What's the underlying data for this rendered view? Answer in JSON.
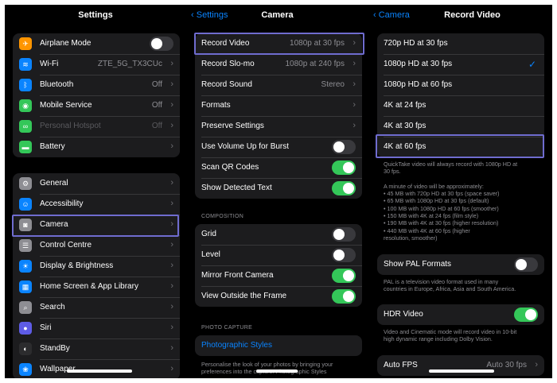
{
  "panel1": {
    "title": "Settings",
    "group1": [
      {
        "label": "Airplane Mode",
        "icon": "airplane-icon",
        "glyph": "✈",
        "color": "#ff9500",
        "type": "toggle",
        "on": false
      },
      {
        "label": "Wi-Fi",
        "icon": "wifi-icon",
        "glyph": "≋",
        "color": "#0a84ff",
        "value": "ZTE_5G_TX3CUc"
      },
      {
        "label": "Bluetooth",
        "icon": "bluetooth-icon",
        "glyph": "ᛒ",
        "color": "#0a84ff",
        "value": "Off"
      },
      {
        "label": "Mobile Service",
        "icon": "antenna-icon",
        "glyph": "◉",
        "color": "#34c759",
        "value": "Off"
      },
      {
        "label": "Personal Hotspot",
        "icon": "hotspot-icon",
        "glyph": "∞",
        "color": "#34c759",
        "value": "Off",
        "dimmed": true
      },
      {
        "label": "Battery",
        "icon": "battery-icon",
        "glyph": "▬",
        "color": "#34c759"
      }
    ],
    "group2": [
      {
        "label": "General",
        "icon": "gear-icon",
        "glyph": "⚙",
        "color": "#8e8e93"
      },
      {
        "label": "Accessibility",
        "icon": "accessibility-icon",
        "glyph": "☺",
        "color": "#0a84ff"
      },
      {
        "label": "Camera",
        "icon": "camera-icon",
        "glyph": "◙",
        "color": "#8e8e93"
      },
      {
        "label": "Control Centre",
        "icon": "control-centre-icon",
        "glyph": "☰",
        "color": "#8e8e93"
      },
      {
        "label": "Display & Brightness",
        "icon": "brightness-icon",
        "glyph": "☀",
        "color": "#0a84ff"
      },
      {
        "label": "Home Screen & App Library",
        "icon": "home-screen-icon",
        "glyph": "▦",
        "color": "#0a84ff"
      },
      {
        "label": "Search",
        "icon": "search-icon",
        "glyph": "⌕",
        "color": "#8e8e93"
      },
      {
        "label": "Siri",
        "icon": "siri-icon",
        "glyph": "●",
        "color": "#5e5ce6"
      },
      {
        "label": "StandBy",
        "icon": "standby-icon",
        "glyph": "◐",
        "color": "#2c2c2e"
      },
      {
        "label": "Wallpaper",
        "icon": "wallpaper-icon",
        "glyph": "❀",
        "color": "#0a84ff"
      }
    ]
  },
  "panel2": {
    "back": "Settings",
    "title": "Camera",
    "group1": [
      {
        "label": "Record Video",
        "value": "1080p at 30 fps",
        "type": "chevron"
      },
      {
        "label": "Record Slo-mo",
        "value": "1080p at 240 fps",
        "type": "chevron"
      },
      {
        "label": "Record Sound",
        "value": "Stereo",
        "type": "chevron"
      },
      {
        "label": "Formats",
        "type": "chevron"
      },
      {
        "label": "Preserve Settings",
        "type": "chevron"
      },
      {
        "label": "Use Volume Up for Burst",
        "type": "toggle",
        "on": false
      },
      {
        "label": "Scan QR Codes",
        "type": "toggle",
        "on": true
      },
      {
        "label": "Show Detected Text",
        "type": "toggle",
        "on": true
      }
    ],
    "composition_header": "COMPOSITION",
    "group2": [
      {
        "label": "Grid",
        "type": "toggle",
        "on": false
      },
      {
        "label": "Level",
        "type": "toggle",
        "on": false
      },
      {
        "label": "Mirror Front Camera",
        "type": "toggle",
        "on": true
      },
      {
        "label": "View Outside the Frame",
        "type": "toggle",
        "on": true
      }
    ],
    "photo_header": "PHOTO CAPTURE",
    "photographic_styles": "Photographic Styles",
    "photo_note": "Personalise the look of your photos by bringing your preferences into the capture. Photographic Styles"
  },
  "panel3": {
    "back": "Camera",
    "title": "Record Video",
    "options": [
      {
        "label": "720p HD at 30 fps",
        "selected": false
      },
      {
        "label": "1080p HD at 30 fps",
        "selected": true
      },
      {
        "label": "1080p HD at 60 fps",
        "selected": false
      },
      {
        "label": "4K at 24 fps",
        "selected": false
      },
      {
        "label": "4K at 30 fps",
        "selected": false
      },
      {
        "label": "4K at 60 fps",
        "selected": false
      }
    ],
    "checkmark": "✓",
    "note_lines": [
      "QuickTake video will always record with 1080p HD at",
      "30 fps.",
      "",
      "A minute of video will be approximately:",
      "• 45 MB with 720p HD at 30 fps (space saver)",
      "• 65 MB with 1080p HD at 30 fps (default)",
      "• 100 MB with 1080p HD at 60 fps (smoother)",
      "• 150 MB with 4K at 24 fps (film style)",
      "• 190 MB with 4K at 30 fps (higher resolution)",
      "• 440 MB with 4K at 60 fps (higher",
      "resolution, smoother)"
    ],
    "pal_label": "Show PAL Formats",
    "pal_on": false,
    "pal_note_lines": [
      "PAL is a television video format used in many",
      "countries in Europe, Africa, Asia and South America."
    ],
    "hdr_label": "HDR Video",
    "hdr_on": true,
    "hdr_note_lines": [
      "Video and Cinematic mode will record video in 10-bit",
      "high dynamic range including Dolby Vision."
    ],
    "autofps_label": "Auto FPS",
    "autofps_value": "Auto 30 fps"
  },
  "chevron": "›",
  "back_chevron": "‹"
}
